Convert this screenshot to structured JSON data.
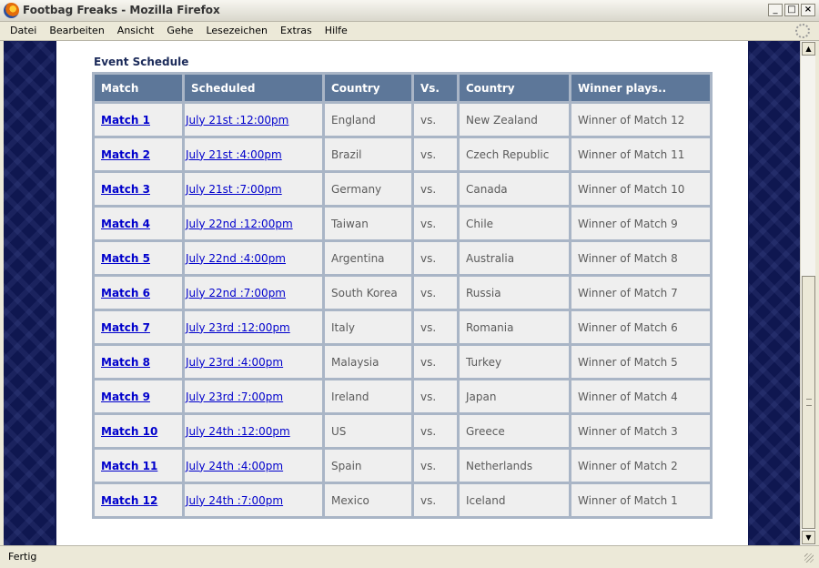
{
  "window": {
    "title": "Footbag Freaks - Mozilla Firefox"
  },
  "menubar": {
    "items": [
      "Datei",
      "Bearbeiten",
      "Ansicht",
      "Gehe",
      "Lesezeichen",
      "Extras",
      "Hilfe"
    ]
  },
  "page": {
    "section_title": "Event Schedule",
    "columns": [
      "Match",
      "Scheduled",
      "Country",
      "Vs.",
      "Country",
      "Winner plays.."
    ],
    "rows": [
      {
        "match": "Match 1",
        "scheduled": "July 21st :12:00pm",
        "country1": "England",
        "vs": "vs.",
        "country2": "New Zealand",
        "winner": "Winner of Match 12"
      },
      {
        "match": "Match 2",
        "scheduled": "July 21st :4:00pm",
        "country1": "Brazil",
        "vs": "vs.",
        "country2": "Czech Republic",
        "winner": "Winner of Match 11"
      },
      {
        "match": "Match 3",
        "scheduled": "July 21st :7:00pm",
        "country1": "Germany",
        "vs": "vs.",
        "country2": "Canada",
        "winner": "Winner of Match 10"
      },
      {
        "match": "Match 4",
        "scheduled": "July 22nd :12:00pm",
        "country1": "Taiwan",
        "vs": "vs.",
        "country2": "Chile",
        "winner": "Winner of Match 9"
      },
      {
        "match": "Match 5",
        "scheduled": "July 22nd :4:00pm",
        "country1": "Argentina",
        "vs": "vs.",
        "country2": "Australia",
        "winner": "Winner of Match 8"
      },
      {
        "match": "Match 6",
        "scheduled": "July 22nd :7:00pm",
        "country1": "South Korea",
        "vs": "vs.",
        "country2": "Russia",
        "winner": "Winner of Match 7"
      },
      {
        "match": "Match 7",
        "scheduled": "July 23rd :12:00pm",
        "country1": "Italy",
        "vs": "vs.",
        "country2": "Romania",
        "winner": "Winner of Match 6"
      },
      {
        "match": "Match 8",
        "scheduled": "July 23rd :4:00pm",
        "country1": "Malaysia",
        "vs": "vs.",
        "country2": "Turkey",
        "winner": "Winner of Match 5"
      },
      {
        "match": "Match 9",
        "scheduled": "July 23rd :7:00pm",
        "country1": "Ireland",
        "vs": "vs.",
        "country2": "Japan",
        "winner": "Winner of Match 4"
      },
      {
        "match": "Match 10",
        "scheduled": "July 24th :12:00pm",
        "country1": "US",
        "vs": "vs.",
        "country2": "Greece",
        "winner": "Winner of Match 3"
      },
      {
        "match": "Match 11",
        "scheduled": "July 24th :4:00pm",
        "country1": "Spain",
        "vs": "vs.",
        "country2": "Netherlands",
        "winner": "Winner of Match 2"
      },
      {
        "match": "Match 12",
        "scheduled": "July 24th :7:00pm",
        "country1": "Mexico",
        "vs": "vs.",
        "country2": "Iceland",
        "winner": "Winner of Match 1"
      }
    ]
  },
  "statusbar": {
    "text": "Fertig"
  },
  "colors": {
    "header_bg": "#5d7799",
    "cell_bg": "#efefef",
    "link": "#0000cc",
    "page_bg": "#0f1750"
  },
  "icons": [
    "firefox-icon",
    "minimize-icon",
    "maximize-icon",
    "close-icon",
    "throbber-icon",
    "scroll-up-icon",
    "scroll-down-icon",
    "resize-grip-icon"
  ]
}
